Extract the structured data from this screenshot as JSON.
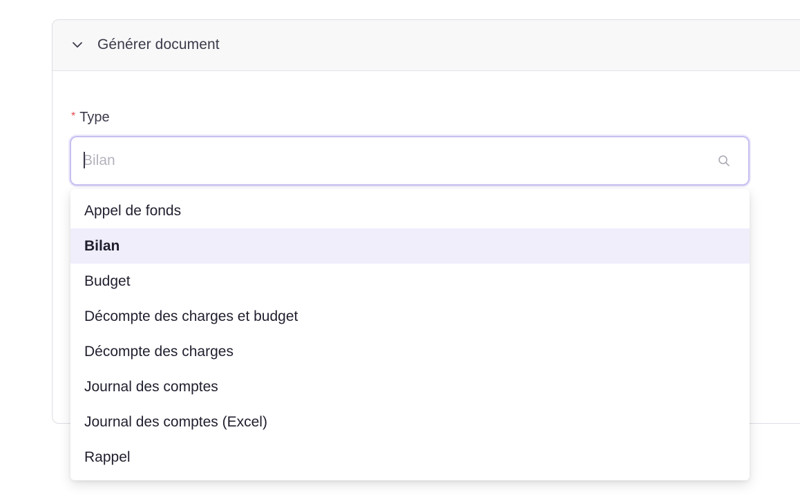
{
  "panel": {
    "title": "Générer document"
  },
  "field": {
    "required_marker": "*",
    "label": "Type",
    "placeholder": "Bilan",
    "value": ""
  },
  "dropdown": {
    "selected_value": "Bilan",
    "options": [
      {
        "label": "Appel de fonds"
      },
      {
        "label": "Bilan"
      },
      {
        "label": "Budget"
      },
      {
        "label": "Décompte des charges et budget"
      },
      {
        "label": "Décompte des charges"
      },
      {
        "label": "Journal des comptes"
      },
      {
        "label": "Journal des comptes (Excel)"
      },
      {
        "label": "Rappel"
      }
    ]
  },
  "icons": {
    "collapse": "chevron-down-icon",
    "search": "search-icon"
  },
  "colors": {
    "accent_border": "#c6bff0",
    "selected_bg": "#f0eefb",
    "required": "#e5484d"
  }
}
